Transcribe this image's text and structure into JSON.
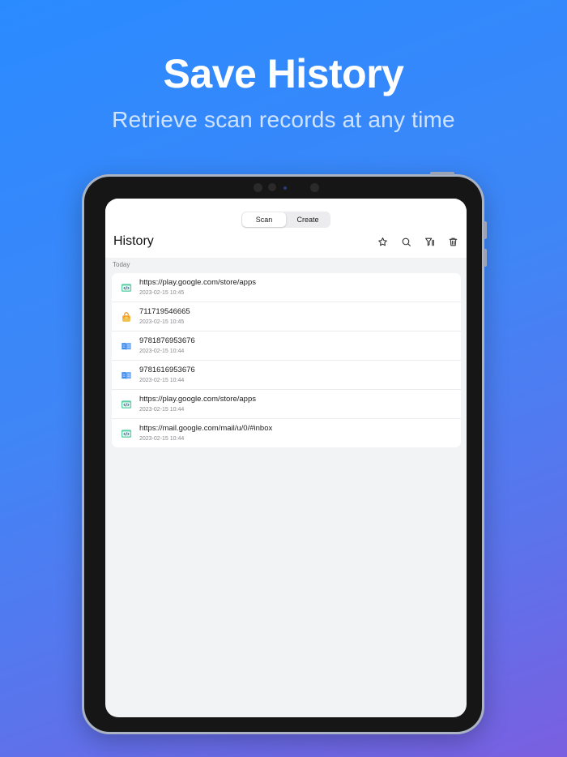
{
  "promo": {
    "title": "Save History",
    "subtitle": "Retrieve scan records at any time"
  },
  "segmented": {
    "items": [
      {
        "label": "Scan",
        "active": true
      },
      {
        "label": "Create",
        "active": false
      }
    ]
  },
  "nav": {
    "title": "History",
    "actions": [
      "star-icon",
      "search-icon",
      "filter-icon",
      "trash-icon"
    ]
  },
  "section": {
    "label": "Today"
  },
  "history": [
    {
      "type": "url-icon",
      "value": "https://play.google.com/store/apps",
      "time": "2023-02-15 10:45"
    },
    {
      "type": "product-icon",
      "value": "711719546665",
      "time": "2023-02-15 10:45"
    },
    {
      "type": "book-icon",
      "value": "9781876953676",
      "time": "2023-02-15 10:44"
    },
    {
      "type": "book-icon",
      "value": "9781616953676",
      "time": "2023-02-15 10:44"
    },
    {
      "type": "url-icon",
      "value": "https://play.google.com/store/apps",
      "time": "2023-02-15 10:44"
    },
    {
      "type": "url-icon",
      "value": "https://mail.google.com/mail/u/0/#inbox",
      "time": "2023-02-15 10:44"
    }
  ],
  "colors": {
    "background_start": "#2a8bff",
    "background_end": "#7a5fe0",
    "url_icon": "#5fd0a8",
    "product_icon": "#f5a623",
    "book_icon": "#3f8cf0"
  }
}
